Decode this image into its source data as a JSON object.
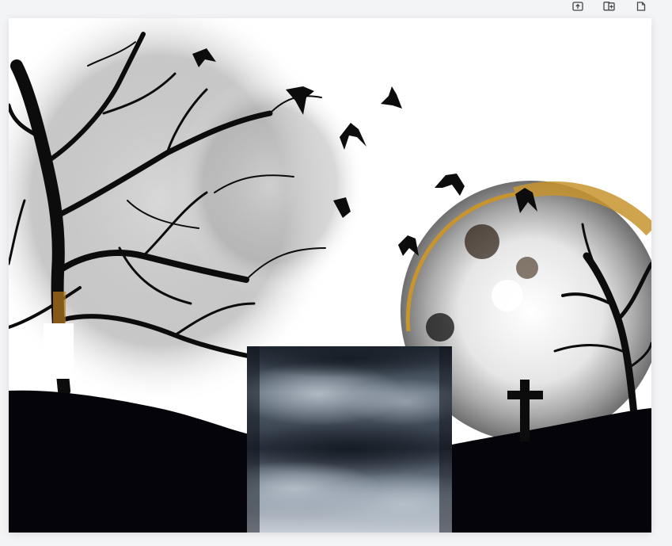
{
  "toolbar": {
    "icons": [
      "upload-icon",
      "add-page-icon",
      "page-icon"
    ]
  },
  "canvas": {
    "background_color": "#ffffff",
    "ground_color": "#05040a",
    "moon_color": "#c8942e",
    "branch_color": "#0c0c0c"
  },
  "layers": [
    {
      "name": "graveyard-scene",
      "description_visible": false
    },
    {
      "name": "stormy-clouds-image",
      "description_visible": false
    }
  ]
}
